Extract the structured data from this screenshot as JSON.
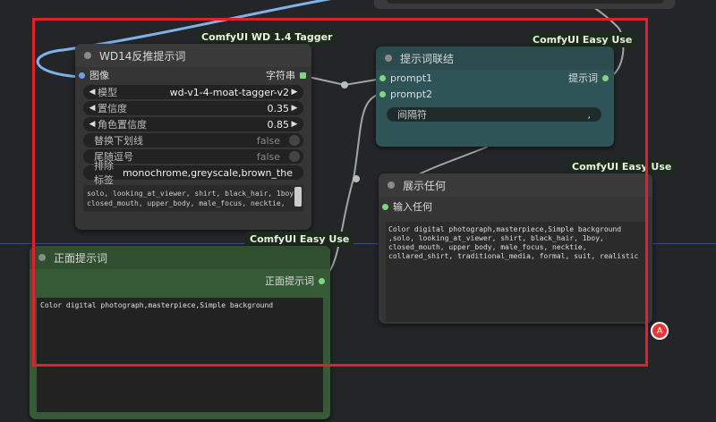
{
  "top_node": {
    "value": "false"
  },
  "wd14": {
    "badge": "ComfyUI WD 1.4 Tagger",
    "title": "WD14反推提示词",
    "input": "图像",
    "output": "字符串",
    "model_label": "模型",
    "model_value": "wd-v1-4-moat-tagger-v2",
    "confidence_label": "置信度",
    "confidence_value": "0.35",
    "char_conf_label": "角色置信度",
    "char_conf_value": "0.85",
    "underscore_label": "替换下划线",
    "underscore_value": "false",
    "comma_label": "尾随逗号",
    "comma_value": "false",
    "exclude_label": "排除标签",
    "exclude_value": "monochrome,greyscale,brown_the",
    "text_line1": "solo, looking_at_viewer, shirt, black_hair, 1boy,",
    "text_line2": "closed_mouth, upper_body, male_focus, necktie,"
  },
  "concat": {
    "badge": "ComfyUI Easy Use",
    "title": "提示词联结",
    "input1": "prompt1",
    "input2": "prompt2",
    "output": "提示词",
    "sep_label": "间隔符",
    "sep_value": ","
  },
  "show": {
    "badge": "ComfyUI Easy Use",
    "title": "展示任何",
    "input": "输入任何",
    "text": "Color digital photograph,masterpiece,Simple background\n,solo, looking_at_viewer, shirt, black_hair, 1boy,\nclosed_mouth, upper_body, male_focus, necktie,\ncollared_shirt, traditional_media, formal, suit, realistic"
  },
  "positive": {
    "badge": "ComfyUI Easy Use",
    "title": "正面提示词",
    "output": "正面提示词",
    "text": "Color digital photograph,masterpiece,Simple background"
  },
  "fab": {
    "label": "A"
  }
}
